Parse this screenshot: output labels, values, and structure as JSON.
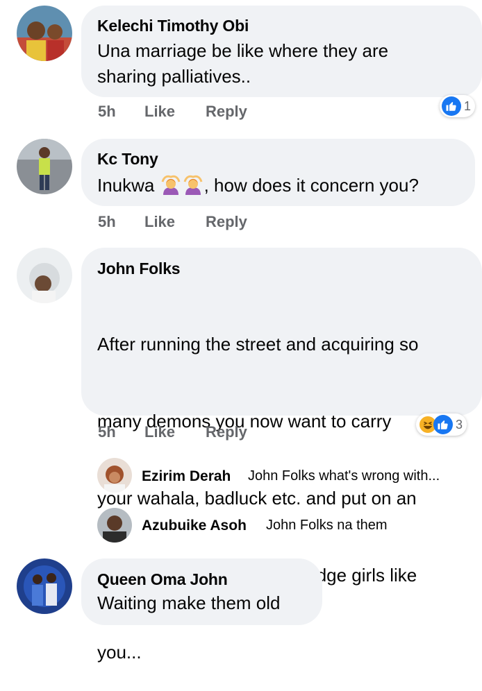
{
  "comments": [
    {
      "author": "Kelechi Timothy Obi",
      "text_lines": [
        "Una marriage be like where they are",
        "sharing palliatives.."
      ],
      "time": "5h",
      "like_label": "Like",
      "reply_label": "Reply",
      "reactions": {
        "types": [
          "like"
        ],
        "count": "1"
      }
    },
    {
      "author": "Kc Tony",
      "text_before": "Inukwa ",
      "emojis": [
        "person-gesturing-ok-emoji",
        "person-gesturing-ok-emoji"
      ],
      "text_after": ", how does it concern you?",
      "time": "5h",
      "like_label": "Like",
      "reply_label": "Reply"
    },
    {
      "author": "John Folks",
      "text_lines": [
        "After running the street and acquiring so",
        "many demons you now want to carry",
        "your wahala, badluck etc. and put on an",
        "innocent man's head,   I Dodge girls like",
        "you..."
      ],
      "time": "5h",
      "like_label": "Like",
      "reply_label": "Reply",
      "reactions": {
        "types": [
          "haha",
          "like"
        ],
        "count": "3"
      },
      "replies": [
        {
          "author": "Ezirim Derah",
          "text": "John Folks what's wrong with..."
        },
        {
          "author": "Azubuike Asoh",
          "text": "John Folks na them"
        }
      ]
    },
    {
      "author": "Queen Oma John",
      "text_lines": [
        "Waiting make them old"
      ]
    }
  ],
  "colors": {
    "bubble": "#f0f2f5",
    "meta": "#65676b",
    "like_blue": "#1877f2",
    "haha_yellow": "#f7b125"
  }
}
